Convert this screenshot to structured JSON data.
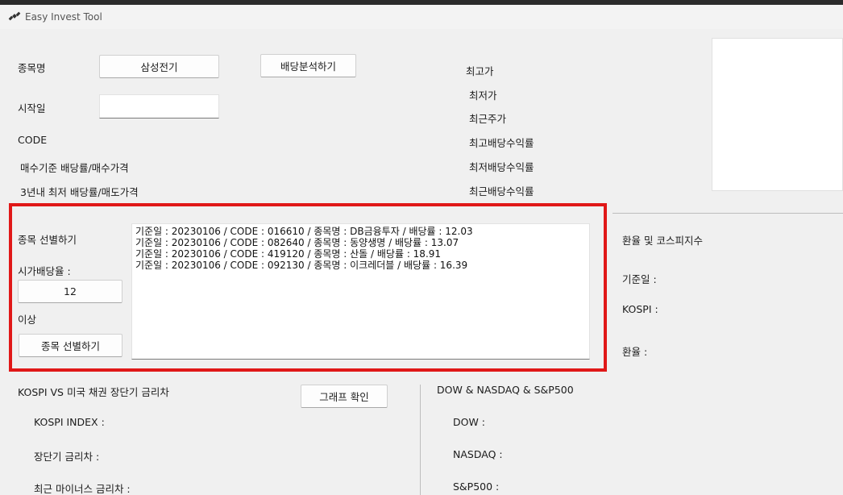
{
  "window": {
    "title": "Easy Invest Tool",
    "app_icon": "satellite-icon"
  },
  "top_form": {
    "stock_name_label": "종목명",
    "stock_name_value": "삼성전기",
    "dividend_analysis_button": "배당분석하기",
    "start_date_label": "시작일",
    "start_date_value": "",
    "code_label": "CODE",
    "buy_basis_label": "매수기준 배당률/매수가격",
    "three_year_label": "3년내 최저 배당률/매도가격"
  },
  "stats": {
    "high_price": "최고가",
    "low_price": "최저가",
    "recent_price": "최근주가",
    "highest_yield": "최고배당수익률",
    "lowest_yield": "최저배당수익률",
    "recent_yield": "최근배당수익률"
  },
  "screener": {
    "section_label": "종목 선별하기",
    "market_yield_label": "시가배당율 :",
    "market_yield_value": "12",
    "above_label": "이상",
    "screen_button": "종목 선별하기",
    "results": [
      "기준일 : 20230106 / CODE : 016610 / 종목명 : DB금융투자 / 배당률 : 12.03",
      "기준일 : 20230106 / CODE : 082640 / 종목명 : 동양생명 / 배당률 : 13.07",
      "기준일 : 20230106 / CODE : 419120 / 종목명 : 산돌 / 배당률 : 18.91",
      "기준일 : 20230106 / CODE : 092130 / 종목명 : 이크레더블 / 배당률 : 16.39"
    ]
  },
  "exchange": {
    "title": "환율 및 코스피지수",
    "base_date": "기준일 :",
    "kospi": "KOSPI :",
    "rate": "환율 :"
  },
  "bond": {
    "title": "KOSPI VS 미국 채권 장단기 금리차",
    "graph_button": "그래프 확인",
    "kospi_index": "KOSPI INDEX :",
    "spread": "장단기 금리차 :",
    "recent_negative": "최근 마이너스 금리차 :"
  },
  "indices": {
    "title": "DOW & NASDAQ & S&P500",
    "dow": "DOW :",
    "nasdaq": "NASDAQ :",
    "sp500": "S&P500 :"
  },
  "highlight_color": "#e01818"
}
